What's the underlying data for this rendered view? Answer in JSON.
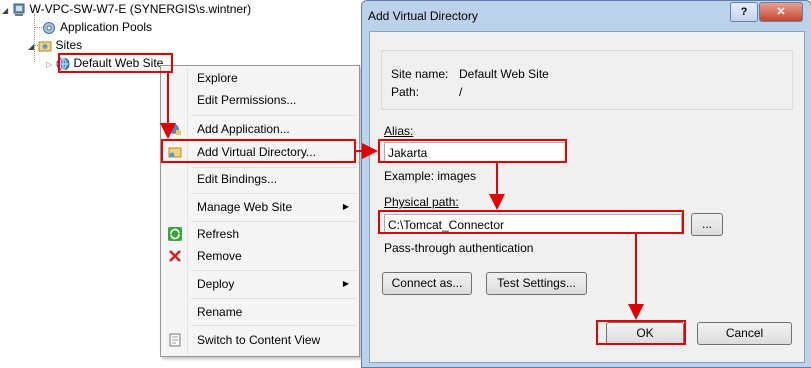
{
  "tree": {
    "server": "W-VPC-SW-W7-E (SYNERGIS\\s.wintner)",
    "app_pools": "Application Pools",
    "sites": "Sites",
    "default_site": "Default Web Site"
  },
  "context_menu": {
    "items": [
      {
        "label": "Explore"
      },
      {
        "label": "Edit Permissions..."
      },
      {
        "label": "Add Application..."
      },
      {
        "label": "Add Virtual Directory..."
      },
      {
        "label": "Edit Bindings..."
      },
      {
        "label": "Manage Web Site"
      },
      {
        "label": "Refresh"
      },
      {
        "label": "Remove"
      },
      {
        "label": "Deploy"
      },
      {
        "label": "Rename"
      },
      {
        "label": "Switch to Content View"
      }
    ]
  },
  "dialog": {
    "title": "Add Virtual Directory",
    "help_btn": "?",
    "close_btn": "✕",
    "site_name_label": "Site name:",
    "site_name_value": "Default Web Site",
    "path_label": "Path:",
    "path_value": "/",
    "alias_label": "Alias:",
    "alias_value": "Jakarta",
    "example": "Example: images",
    "physical_path_label": "Physical path:",
    "physical_path_value": "C:\\Tomcat_Connector",
    "browse_btn": "...",
    "passthrough": "Pass-through authentication",
    "connect_as_btn": "Connect as...",
    "test_settings_btn": "Test Settings...",
    "ok_btn": "OK",
    "cancel_btn": "Cancel"
  },
  "colors": {
    "highlight": "#e00000",
    "dialog_frame": "#bcd1ea",
    "client_bg": "#f0f0f0"
  }
}
